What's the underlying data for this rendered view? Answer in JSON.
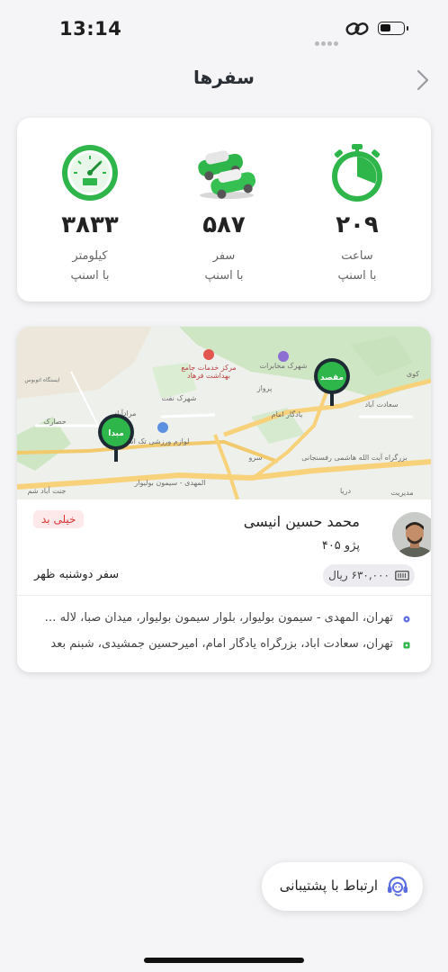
{
  "status_bar": {
    "time": "13:14"
  },
  "header": {
    "title": "سفرها"
  },
  "stats": [
    {
      "value": "۳۸۳۳",
      "label": "کیلومتر",
      "sub": "با اسنپ",
      "icon": "speedometer-icon"
    },
    {
      "value": "۵۸۷",
      "label": "سفر",
      "sub": "با اسنپ",
      "icon": "cars-icon"
    },
    {
      "value": "۲۰۹",
      "label": "ساعت",
      "sub": "با اسنپ",
      "icon": "stopwatch-icon"
    }
  ],
  "trip": {
    "map": {
      "origin_label": "مبدا",
      "destination_label": "مقصد",
      "places": {
        "p1": "مرکز خدمات جامع",
        "p2": "بهداشت فرهاد",
        "p3": "شهرک مخابرات",
        "p4": "ایستگاه اتوبوس",
        "p5": "شهرک نفت",
        "p6": "پرواز",
        "p7": "مرادآباد",
        "p8": "لوازم ورزشی تک اسپرت",
        "p9": "حصارک",
        "p10": "یادگار امام",
        "p11": "سعادت آباد",
        "p12": "کوی",
        "p13": "بزرگراه آیت الله هاشمی رفسنجانی",
        "p14": "سرو",
        "p15": "المهدی - سیمون بولیوار",
        "p16": "جنت آباد شم",
        "p17": "دریا",
        "p18": "مدیریت"
      }
    },
    "driver_name": "محمد حسین انیسی",
    "car": "پژو ۴۰۵",
    "rating": "خیلی بد",
    "date": "سفر دوشنبه ظهر",
    "price": "۶۳۰,۰۰۰ ریال",
    "origin_address": "تهران، المهدی - سیمون بولیوار، بلوار سیمون بولیوار، میدان صبا، لاله ش...",
    "destination_address": "تهران، سعادت آباد، بزرگراه یادگار امام، امیرحسین جمشیدی، شبنم بعد"
  },
  "support": {
    "label": "ارتباط با پشتیبانی"
  },
  "colors": {
    "snapp_green": "#2fb64a",
    "origin_dot": "#5b6ee1",
    "destination_dot": "#2fb64a",
    "rating_red": "#d33333"
  }
}
